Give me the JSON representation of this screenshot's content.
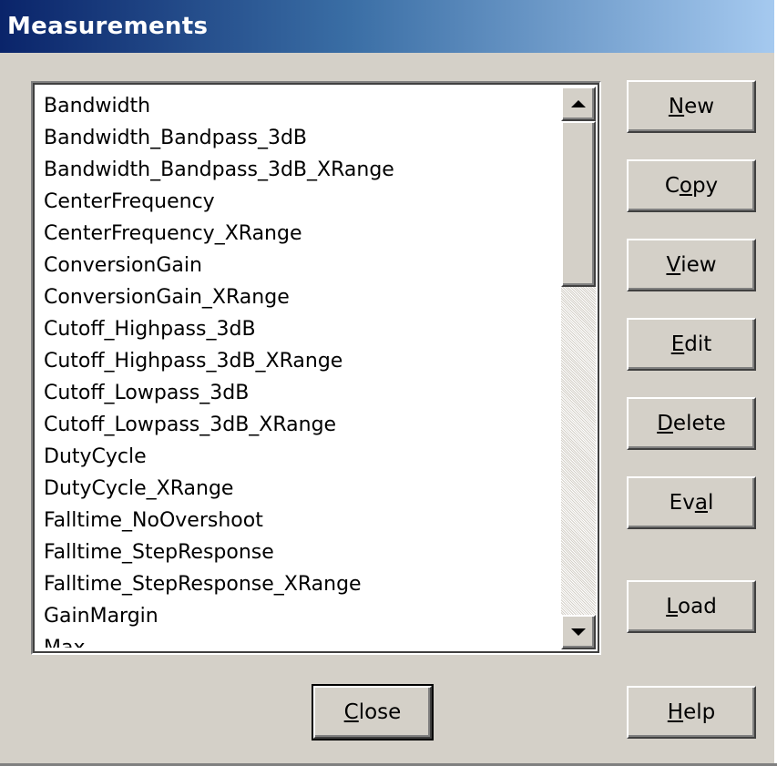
{
  "window": {
    "title": "Measurements"
  },
  "list": {
    "items": [
      "Bandwidth",
      "Bandwidth_Bandpass_3dB",
      "Bandwidth_Bandpass_3dB_XRange",
      "CenterFrequency",
      "CenterFrequency_XRange",
      "ConversionGain",
      "ConversionGain_XRange",
      "Cutoff_Highpass_3dB",
      "Cutoff_Highpass_3dB_XRange",
      "Cutoff_Lowpass_3dB",
      "Cutoff_Lowpass_3dB_XRange",
      "DutyCycle",
      "DutyCycle_XRange",
      "Falltime_NoOvershoot",
      "Falltime_StepResponse",
      "Falltime_StepResponse_XRange",
      "GainMargin",
      "Max"
    ]
  },
  "buttons": {
    "new": {
      "pre": "",
      "mnemonic": "N",
      "post": "ew"
    },
    "copy": {
      "pre": "C",
      "mnemonic": "o",
      "post": "py"
    },
    "view": {
      "pre": "",
      "mnemonic": "V",
      "post": "iew"
    },
    "edit": {
      "pre": "",
      "mnemonic": "E",
      "post": "dit"
    },
    "delete": {
      "pre": "",
      "mnemonic": "D",
      "post": "elete"
    },
    "eval": {
      "pre": "Ev",
      "mnemonic": "a",
      "post": "l"
    },
    "load": {
      "pre": "",
      "mnemonic": "L",
      "post": "oad"
    },
    "help": {
      "pre": "",
      "mnemonic": "H",
      "post": "elp"
    },
    "close": {
      "pre": "",
      "mnemonic": "C",
      "post": "lose"
    }
  },
  "icons": {
    "scroll_up": "triangle-up-icon",
    "scroll_down": "triangle-down-icon"
  },
  "colors": {
    "title_start": "#0a246a",
    "title_end": "#a6caf0",
    "face": "#d4d0c8"
  }
}
